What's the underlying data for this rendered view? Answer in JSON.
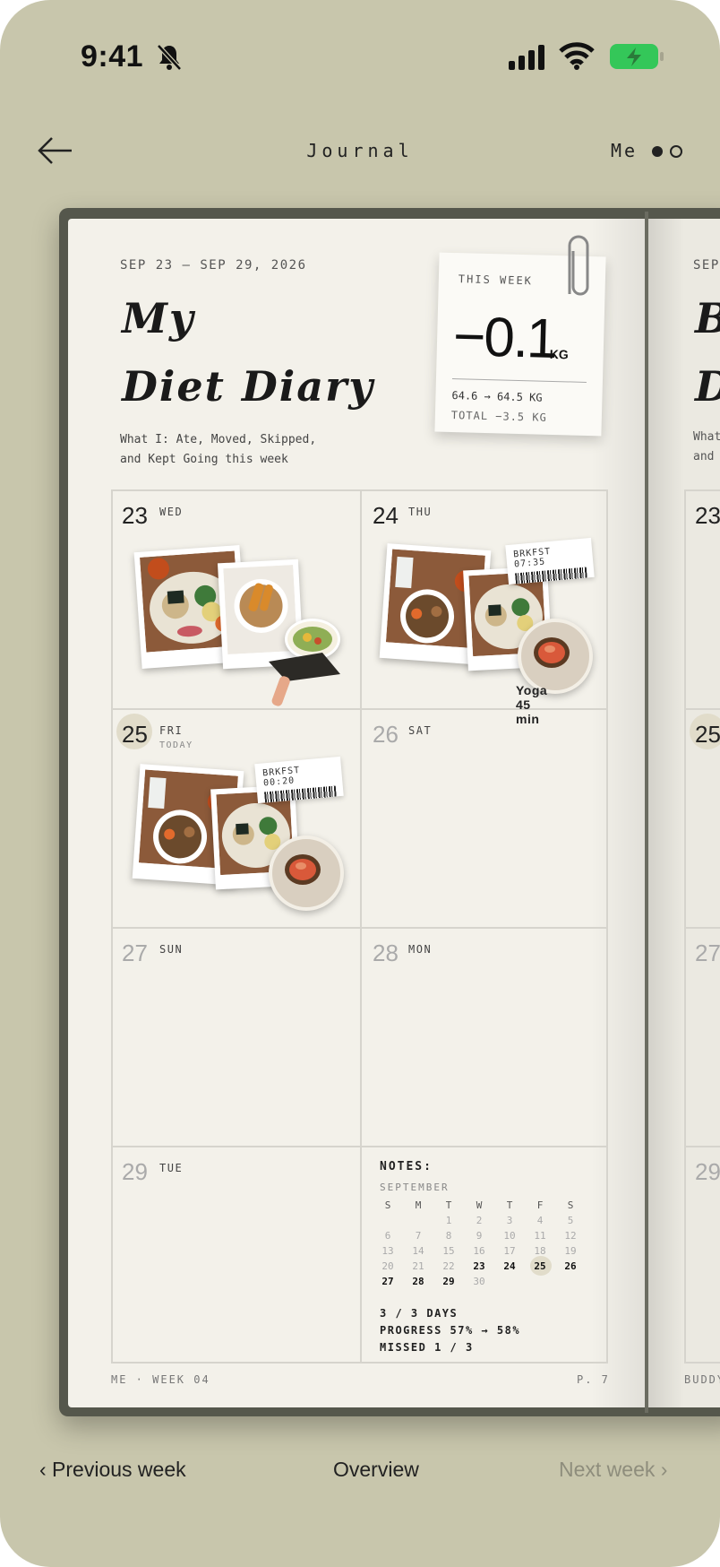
{
  "status_bar": {
    "time": "9:41",
    "icons": [
      "bell-slash-icon",
      "cellular-signal-icon",
      "wifi-icon",
      "battery-charging-icon"
    ]
  },
  "nav": {
    "title": "Journal",
    "profile_label": "Me",
    "page_dots": 2,
    "active_dot": 1
  },
  "journal": {
    "date_range": "SEP 23 — SEP 29, 2026",
    "title_line1": "My",
    "title_line2": "Diet Diary",
    "subtitle_line1": "What I: Ate, Moved, Skipped,",
    "subtitle_line2": "and Kept Going this week",
    "weekly_note": {
      "label": "THIS WEEK",
      "change": "−0.1",
      "unit": "KG",
      "weights": "64.6 → 64.5 KG",
      "total": "TOTAL −3.5 KG"
    },
    "days": [
      {
        "num": "23",
        "name": "WED",
        "has_entries": true
      },
      {
        "num": "24",
        "name": "THU",
        "has_entries": true,
        "receipt": "BRKFST 07:35",
        "activity": "Yoga 45 min"
      },
      {
        "num": "25",
        "name": "FRI",
        "tag": "TODAY",
        "has_entries": true,
        "receipt": "BRKFST 00:20"
      },
      {
        "num": "26",
        "name": "SAT",
        "has_entries": false
      },
      {
        "num": "27",
        "name": "SUN",
        "has_entries": false
      },
      {
        "num": "28",
        "name": "MON",
        "has_entries": false
      },
      {
        "num": "29",
        "name": "TUE",
        "has_entries": false
      }
    ],
    "notes": {
      "title": "NOTES:",
      "month": "SEPTEMBER",
      "weekdays": [
        "S",
        "M",
        "T",
        "W",
        "T",
        "F",
        "S"
      ],
      "weeks": [
        [
          "",
          "",
          "1",
          "2",
          "3",
          "4",
          "5"
        ],
        [
          "6",
          "7",
          "8",
          "9",
          "10",
          "11",
          "12"
        ],
        [
          "13",
          "14",
          "15",
          "16",
          "17",
          "18",
          "19"
        ],
        [
          "20",
          "21",
          "22",
          "23",
          "24",
          "25",
          "26"
        ],
        [
          "27",
          "28",
          "29",
          "30",
          "",
          "",
          ""
        ]
      ],
      "highlighted_days": [
        "23",
        "24",
        "25",
        "26",
        "27",
        "28",
        "29"
      ],
      "today": "25",
      "stats": [
        "3 / 3 DAYS",
        "PROGRESS 57% → 58%",
        "MISSED 1 / 3"
      ]
    },
    "footer_left": "ME · WEEK 04",
    "footer_right": "P. 7"
  },
  "next_page_peek": {
    "date_fragment": "SEP",
    "title_fragment_1": "B",
    "title_fragment_2": "D",
    "subtitle_fragment_1": "What",
    "subtitle_fragment_2": "and",
    "day_nums": [
      "23",
      "25",
      "27",
      "29"
    ],
    "footer_fragment": "BUDDY"
  },
  "bottom_nav": {
    "previous": "‹ Previous week",
    "overview": "Overview",
    "next": "Next week ›"
  }
}
